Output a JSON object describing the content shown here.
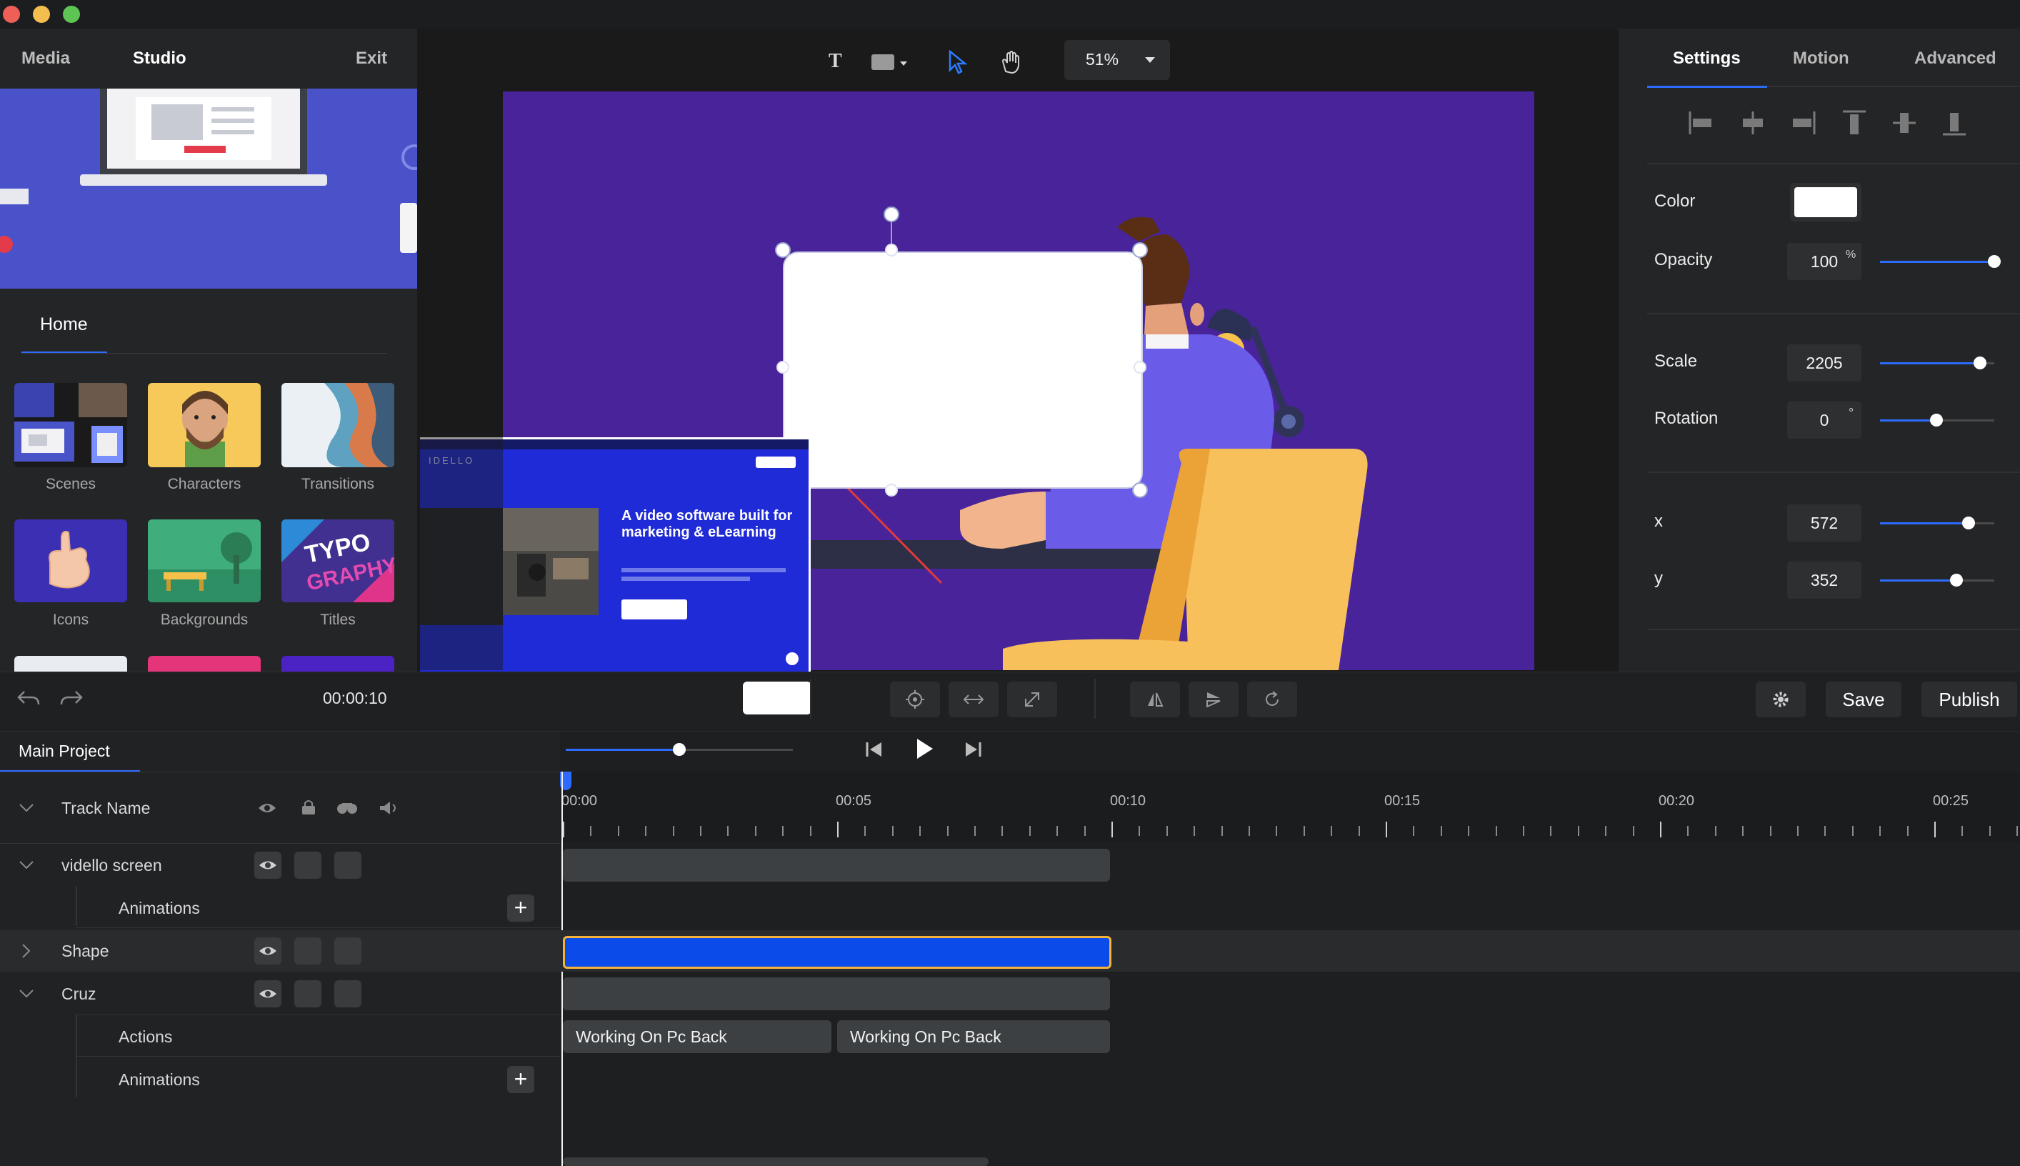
{
  "left_tabs": [
    "Media",
    "Studio",
    "Exit"
  ],
  "home_label": "Home",
  "library": [
    "Scenes",
    "Characters",
    "Transitions",
    "Icons",
    "Backgrounds",
    "Titles"
  ],
  "toolbar": {
    "zoom": "51%",
    "text_tool": "T"
  },
  "canvas": {
    "website_headline": "A video software built for marketing & eLearning",
    "website_logo": "IDELLO"
  },
  "right_tabs": [
    "Settings",
    "Motion",
    "Advanced"
  ],
  "properties": {
    "color_label": "Color",
    "opacity_label": "Opacity",
    "opacity_value": "100",
    "opacity_unit": "%",
    "scale_label": "Scale",
    "scale_value": "2205",
    "rotation_label": "Rotation",
    "rotation_value": "0",
    "rotation_unit": "°",
    "x_label": "x",
    "x_value": "572",
    "y_label": "y",
    "y_value": "352"
  },
  "controls": {
    "time": "00:00:10",
    "save": "Save",
    "publish": "Publish"
  },
  "timeline": {
    "project": "Main Project",
    "track_header": "Track Name",
    "tracks": [
      "vidello screen",
      "Animations",
      "Shape",
      "Cruz",
      "Actions",
      "Animations"
    ],
    "clip_labels": [
      "Working On Pc Back",
      "Working On Pc Back"
    ],
    "ruler": [
      "00:00",
      "00:05",
      "00:10",
      "00:15",
      "00:20",
      "00:25"
    ],
    "zoom_fraction": 0.5
  },
  "colors": {
    "accent": "#2d6bff",
    "canvas_bg": "#48239a",
    "clip_selected": "#0a4bea",
    "clip_border": "#f5b33a"
  }
}
